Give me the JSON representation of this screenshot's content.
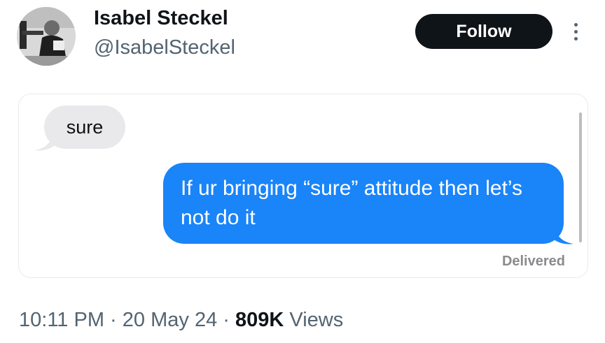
{
  "author": {
    "display_name": "Isabel Steckel",
    "handle": "@IsabelSteckel",
    "avatar": "profile-photo"
  },
  "actions": {
    "follow_label": "Follow",
    "more_icon": "more-vertical-icon"
  },
  "media": {
    "received_message": "sure",
    "sent_message": "If ur bringing “sure” attitude then let’s not do it",
    "status": "Delivered",
    "colors": {
      "received_bubble": "#e9e9eb",
      "sent_bubble": "#1a84f9"
    }
  },
  "meta": {
    "time": "10:11 PM",
    "separator": "·",
    "date": "20 May 24",
    "views_count": "809K",
    "views_label": "Views"
  }
}
